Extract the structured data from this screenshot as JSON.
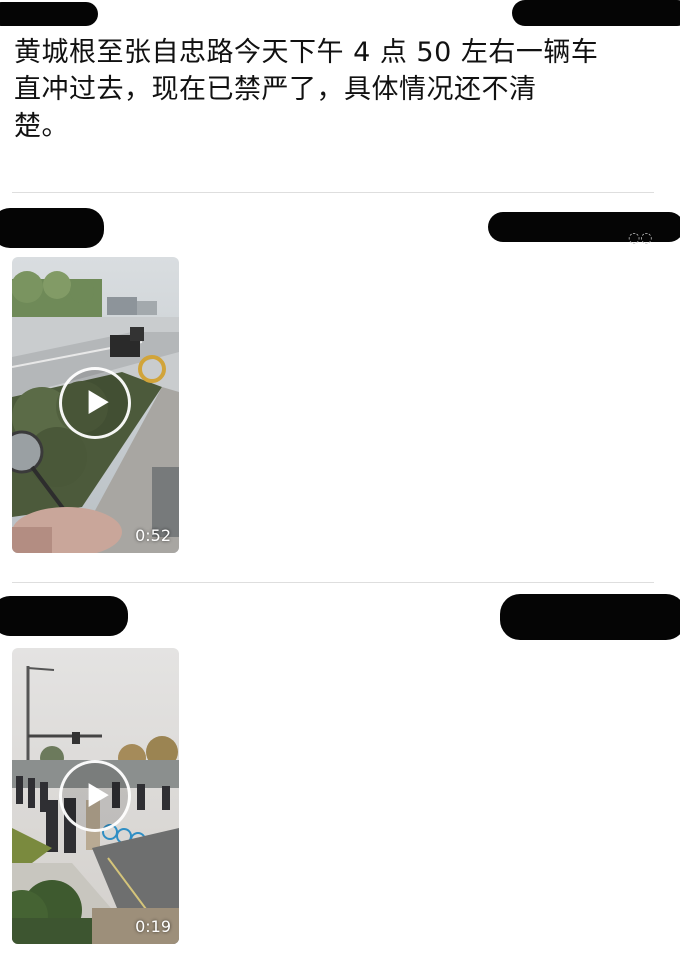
{
  "post": {
    "text_lines": [
      "黄城根至张自忠路今天下午 4 点 50 左右一辆车",
      "直冲过去，现在已禁严了，具体情况还不清",
      "楚。"
    ]
  },
  "videos": [
    {
      "duration": "0:52"
    },
    {
      "duration": "0:19"
    }
  ],
  "colors": {
    "background": "#ffffff",
    "text": "#111111",
    "divider": "#dedede",
    "redaction": "#050505"
  }
}
